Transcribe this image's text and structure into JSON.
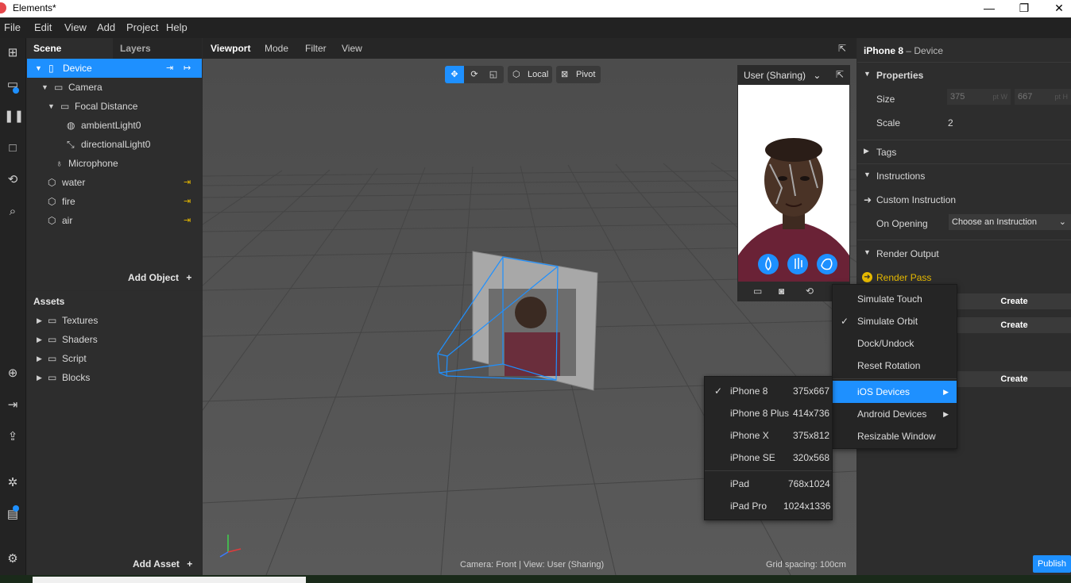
{
  "app": {
    "window_title": "Elements*",
    "minimize": "—",
    "maximize": "❐",
    "close": "✕"
  },
  "menu": [
    "File",
    "Edit",
    "View",
    "Add",
    "Project",
    "Help"
  ],
  "scene": {
    "tabs": [
      "Scene",
      "Layers"
    ],
    "items": [
      {
        "label": "Device"
      },
      {
        "label": "Camera"
      },
      {
        "label": "Focal Distance"
      },
      {
        "label": "ambientLight0"
      },
      {
        "label": "directionalLight0"
      },
      {
        "label": "Microphone"
      },
      {
        "label": "water"
      },
      {
        "label": "fire"
      },
      {
        "label": "air"
      }
    ],
    "add_object": "Add Object"
  },
  "assets": {
    "title": "Assets",
    "folders": [
      "Textures",
      "Shaders",
      "Script",
      "Blocks"
    ],
    "add_asset": "Add Asset"
  },
  "viewport": {
    "title": "Viewport",
    "menus": [
      "Mode",
      "Filter",
      "View"
    ],
    "tools": {
      "local": "Local",
      "pivot": "Pivot"
    },
    "status": "Camera: Front | View: User (Sharing)",
    "grid": "Grid spacing: 100cm"
  },
  "simulator": {
    "user": "User (Sharing)"
  },
  "inspector": {
    "title": "iPhone 8",
    "subtitle": "– Device",
    "properties": "Properties",
    "size_label": "Size",
    "size_w": "375",
    "size_h": "667",
    "unit": "pt W",
    "unit_h": "pt H",
    "scale_label": "Scale",
    "scale_value": "2",
    "tags": "Tags",
    "instructions": "Instructions",
    "custom_instruction": "Custom Instruction",
    "on_opening": "On Opening",
    "choose_instruction": "Choose an Instruction",
    "render_output": "Render Output",
    "render_pass": "Render Pass",
    "create": "Create"
  },
  "context_menu": {
    "items": [
      "Simulate Touch",
      "Simulate Orbit",
      "Dock/Undock",
      "Reset Rotation",
      "iOS Devices",
      "Android Devices",
      "Resizable Window"
    ]
  },
  "ios_menu": {
    "devices": [
      {
        "name": "iPhone 8",
        "res": "375x667"
      },
      {
        "name": "iPhone 8 Plus",
        "res": "414x736"
      },
      {
        "name": "iPhone X",
        "res": "375x812"
      },
      {
        "name": "iPhone SE",
        "res": "320x568"
      },
      {
        "name": "iPad",
        "res": "768x1024"
      },
      {
        "name": "iPad Pro",
        "res": "1024x1336"
      }
    ]
  },
  "publish": "Publish",
  "colors": {
    "accent": "#1e90ff",
    "warning": "#e5b800"
  }
}
